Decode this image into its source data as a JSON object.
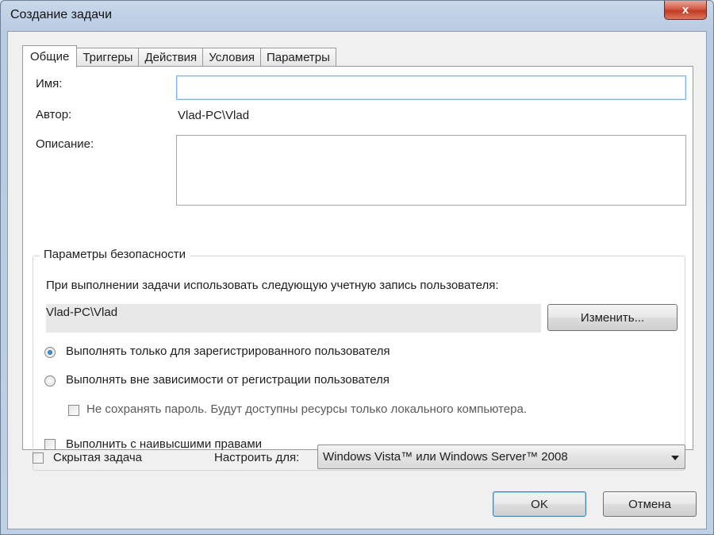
{
  "window": {
    "title": "Создание задачи",
    "close_glyph": "x"
  },
  "tabs": [
    {
      "label": "Общие"
    },
    {
      "label": "Триггеры"
    },
    {
      "label": "Действия"
    },
    {
      "label": "Условия"
    },
    {
      "label": "Параметры"
    }
  ],
  "general": {
    "name_label": "Имя:",
    "name_value": "",
    "author_label": "Автор:",
    "author_value": "Vlad-PC\\Vlad",
    "description_label": "Описание:",
    "description_value": ""
  },
  "security": {
    "group_title": "Параметры безопасности",
    "account_prompt": "При выполнении задачи использовать следующую учетную запись пользователя:",
    "account_value": "Vlad-PC\\Vlad",
    "change_button": "Изменить...",
    "radio_logged_on": "Выполнять только для зарегистрированного пользователя",
    "radio_logged_on_checked": true,
    "radio_any": "Выполнять вне зависимости от регистрации пользователя",
    "radio_any_checked": false,
    "no_password_checkbox": "Не сохранять пароль. Будут доступны ресурсы только локального компьютера.",
    "highest_privileges_checkbox": "Выполнить с наивысшими правами"
  },
  "footer": {
    "hidden_checkbox": "Скрытая задача",
    "configure_label": "Настроить для:",
    "configure_value": "Windows Vista™ или Windows Server™ 2008",
    "ok_button": "OK",
    "cancel_button": "Отмена"
  }
}
